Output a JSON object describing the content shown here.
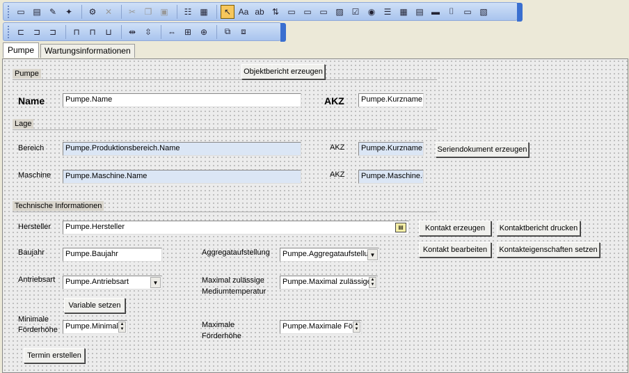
{
  "toolbar1": {
    "buttons": [
      {
        "icon": "form-icon",
        "glyph": "▭"
      },
      {
        "icon": "report-icon",
        "glyph": "▤"
      },
      {
        "icon": "edit-icon",
        "glyph": "✎"
      },
      {
        "icon": "wizard-icon",
        "glyph": "✦"
      },
      {
        "icon": "tool-icon",
        "glyph": "⚙"
      },
      {
        "icon": "delete-icon",
        "glyph": "✕"
      },
      {
        "icon": "cut-icon",
        "glyph": "✂"
      },
      {
        "icon": "copy-icon",
        "glyph": "❐"
      },
      {
        "icon": "paste-icon",
        "glyph": "▣"
      },
      {
        "icon": "properties-icon",
        "glyph": "☷"
      },
      {
        "icon": "calculator-icon",
        "glyph": "▦"
      },
      {
        "icon": "pointer-icon",
        "glyph": "↖"
      },
      {
        "icon": "label-tool-icon",
        "glyph": "Aa"
      },
      {
        "icon": "textbox-tool-icon",
        "glyph": "ab"
      },
      {
        "icon": "tab-order-icon",
        "glyph": "⇅"
      },
      {
        "icon": "combo-tool-icon",
        "glyph": "▭"
      },
      {
        "icon": "date-tool-icon",
        "glyph": "▭"
      },
      {
        "icon": "spin-tool-icon",
        "glyph": "▭"
      },
      {
        "icon": "image-button-icon",
        "glyph": "▨"
      },
      {
        "icon": "checkbox-tool-icon",
        "glyph": "☑"
      },
      {
        "icon": "radio-tool-icon",
        "glyph": "◉"
      },
      {
        "icon": "list-tool-icon",
        "glyph": "☰"
      },
      {
        "icon": "grid-tool-icon",
        "glyph": "▦"
      },
      {
        "icon": "memo-tool-icon",
        "glyph": "▤"
      },
      {
        "icon": "button-tool-icon",
        "glyph": "▬"
      },
      {
        "icon": "group-tool-icon",
        "glyph": "⌷"
      },
      {
        "icon": "frame-tool-icon",
        "glyph": "▭"
      },
      {
        "icon": "picture-tool-icon",
        "glyph": "▧"
      }
    ]
  },
  "toolbar2": {
    "buttons": [
      {
        "icon": "align-left-icon",
        "glyph": "⊏"
      },
      {
        "icon": "align-center-v-icon",
        "glyph": "⊐"
      },
      {
        "icon": "align-right-icon",
        "glyph": "⊐"
      },
      {
        "icon": "align-top-icon",
        "glyph": "⊓"
      },
      {
        "icon": "align-middle-icon",
        "glyph": "⊓"
      },
      {
        "icon": "align-bottom-icon",
        "glyph": "⊔"
      },
      {
        "icon": "space-horizontal-icon",
        "glyph": "⇹"
      },
      {
        "icon": "space-vertical-icon",
        "glyph": "⇳"
      },
      {
        "icon": "same-width-icon",
        "glyph": "⇔"
      },
      {
        "icon": "same-size-icon",
        "glyph": "⊞"
      },
      {
        "icon": "center-icon",
        "glyph": "⊕"
      },
      {
        "icon": "bring-front-icon",
        "glyph": "⧉"
      },
      {
        "icon": "send-back-icon",
        "glyph": "⧈"
      }
    ]
  },
  "tabs": [
    {
      "label": "Pumpe",
      "active": true
    },
    {
      "label": "Wartungsinformationen",
      "active": false
    }
  ],
  "form": {
    "section_pumpe": "Pumpe",
    "btn_objektbericht": "Objektbericht erzeugen",
    "label_name": "Name",
    "field_name": "Pumpe.Name",
    "label_akz": "AKZ",
    "field_kurzname": "Pumpe.Kurzname",
    "section_lage": "Lage",
    "label_bereich": "Bereich",
    "field_bereich": "Pumpe.Produktionsbereich.Name",
    "label_akz_small": "AKZ",
    "field_kurzname2": "Pumpe.Kurzname",
    "btn_seriendokument": "Seriendokument erzeugen",
    "label_maschine": "Maschine",
    "field_maschine": "Pumpe.Maschine.Name",
    "field_maschine_k": "Pumpe.Maschine.K",
    "section_technik": "Technische Informationen",
    "label_hersteller": "Hersteller",
    "field_hersteller": "Pumpe.Hersteller",
    "btn_kontakt_erzeugen": "Kontakt erzeugen",
    "btn_kontaktbericht": "Kontaktbericht drucken",
    "btn_kontakt_bearbeiten": "Kontakt bearbeiten",
    "btn_kontakteigenschaften": "Kontakteigenschaften setzen",
    "label_baujahr": "Baujahr",
    "field_baujahr": "Pumpe.Baujahr",
    "label_aggregat": "Aggregataufstellung",
    "field_aggregat": "Pumpe.Aggregataufstellu",
    "label_antriebsart": "Antriebsart",
    "field_antriebsart": "Pumpe.Antriebsart",
    "label_maxtemp_1": "Maximal zulässige",
    "label_maxtemp_2": "Mediumtemperatur",
    "field_maxtemp": "Pumpe.Maximal zulässige",
    "btn_variable": "Variable setzen",
    "label_minfoerder_1": "Minimale",
    "label_minfoerder_2": "Förderhöhe",
    "field_minfoerder": "Pumpe.Minimale",
    "label_maxfoerder_1": "Maximale",
    "label_maxfoerder_2": "Förderhöhe",
    "field_maxfoerder": "Pumpe.Maximale För",
    "btn_termin": "Termin erstellen"
  }
}
